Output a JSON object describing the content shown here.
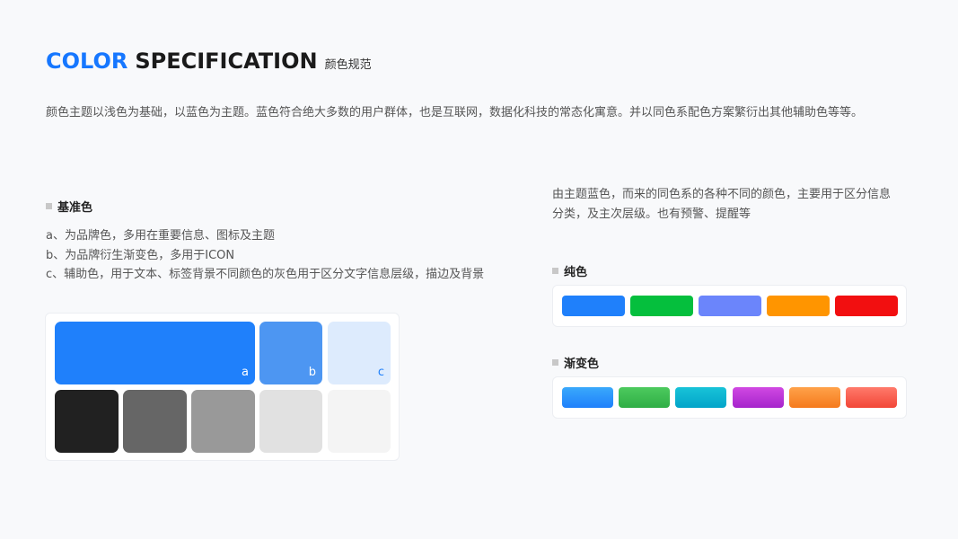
{
  "header": {
    "title_accent": "COLOR",
    "title_main": "SPECIFICATION",
    "title_sub": "颜色规范"
  },
  "intro": "颜色主题以浅色为基础，以蓝色为主题。蓝色符合绝大多数的用户群体，也是互联网，数据化科技的常态化寓意。并以同色系配色方案繁衍出其他辅助色等等。",
  "base": {
    "heading": "基准色",
    "lines": [
      "a、为品牌色，多用在重要信息、图标及主题",
      "b、为品牌衍生渐变色，多用于ICON",
      "c、辅助色，用于文本、标签背景不同颜色的灰色用于区分文字信息层级，描边及背景"
    ],
    "swatch_a": {
      "label": "a",
      "color": "#1f80fb"
    },
    "swatch_b": {
      "label": "b",
      "color": "#4d96f2"
    },
    "swatch_c": {
      "label": "c",
      "color": "#ddebfd"
    },
    "grays": [
      "#212121",
      "#666666",
      "#999999",
      "#e1e1e1",
      "#f4f4f4"
    ]
  },
  "right": {
    "desc_lines": [
      "由主题蓝色，而来的同色系的各种不同的颜色，主要用于区分信息",
      "分类，及主次层级。也有预警、提醒等"
    ],
    "solid_heading": "纯色",
    "solid_colors": [
      "#1f80fb",
      "#05bf3d",
      "#6b85fb",
      "#ff9500",
      "#f20f10"
    ],
    "gradient_heading": "渐变色",
    "gradients": [
      [
        "#3aa9fb",
        "#1f80fb"
      ],
      [
        "#4dca5e",
        "#2fae45"
      ],
      [
        "#18c3d8",
        "#02a4c9"
      ],
      [
        "#d149e3",
        "#a524cc"
      ],
      [
        "#ffa24a",
        "#f57a1c"
      ],
      [
        "#ff7a6b",
        "#f24637"
      ]
    ]
  }
}
